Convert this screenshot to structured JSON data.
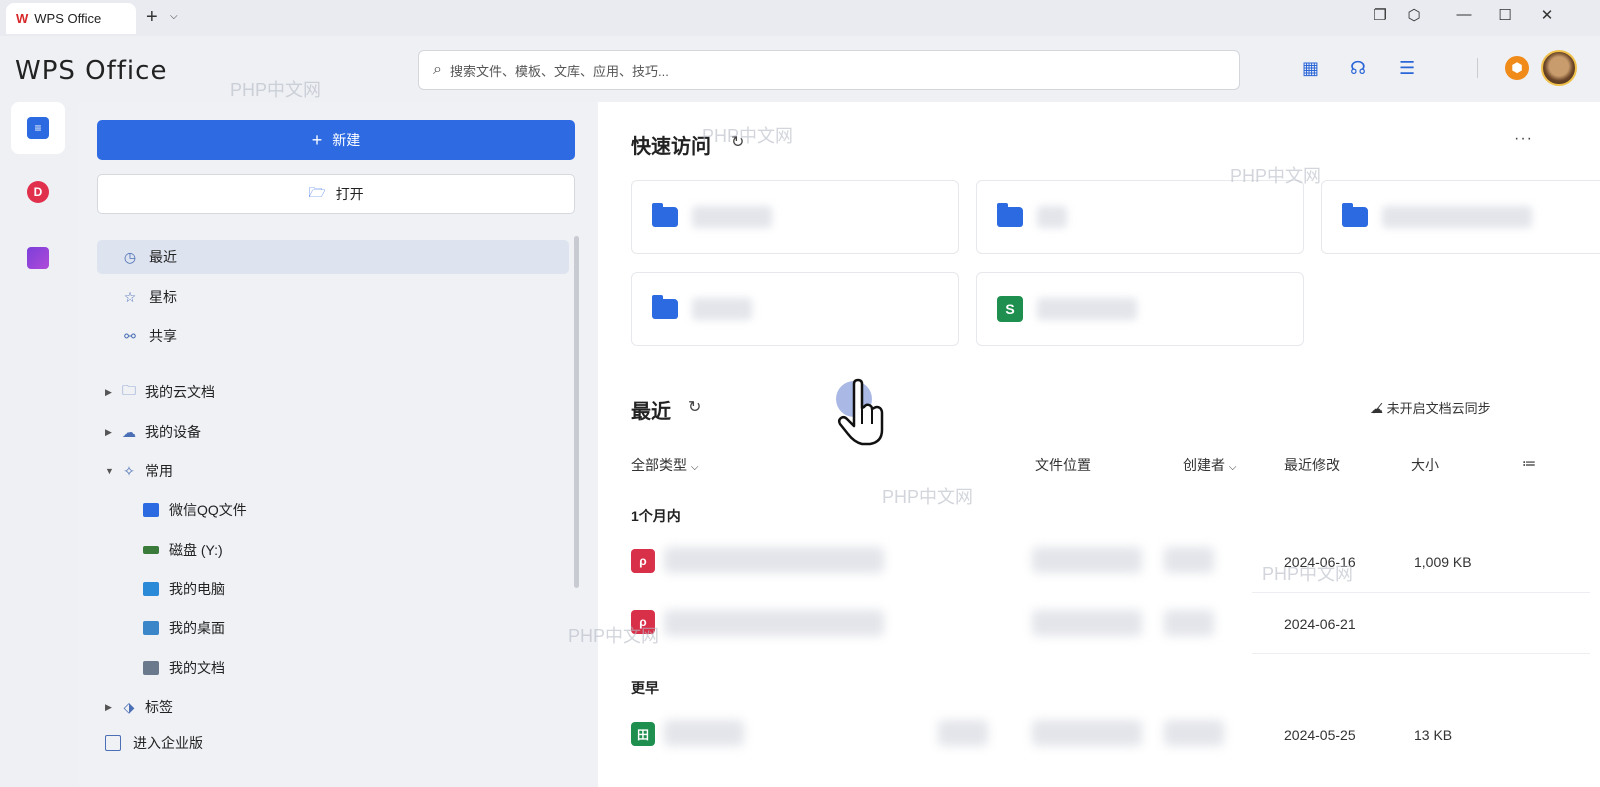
{
  "tab": {
    "title": "WPS Office"
  },
  "header": {
    "brand": "WPS Office",
    "search_placeholder": "搜索文件、模板、文库、应用、技巧..."
  },
  "sidebar": {
    "new_label": "新建",
    "open_label": "打开",
    "nav": [
      {
        "label": "最近",
        "icon": "clock-icon"
      },
      {
        "label": "星标",
        "icon": "star-icon"
      },
      {
        "label": "共享",
        "icon": "share-icon"
      }
    ],
    "tree": [
      {
        "label": "我的云文档",
        "icon": "folder-icon"
      },
      {
        "label": "我的设备",
        "icon": "cloud-device-icon"
      },
      {
        "label": "常用",
        "icon": "pin-icon"
      }
    ],
    "common": [
      {
        "label": "微信QQ文件",
        "color": "#2b6ae0"
      },
      {
        "label": "磁盘 (Y:)",
        "color": "#3a7a3a"
      },
      {
        "label": "我的电脑",
        "color": "#2a8ad8"
      },
      {
        "label": "我的桌面",
        "color": "#3a86c8"
      },
      {
        "label": "我的文档",
        "color": "#6a7a8c"
      }
    ],
    "tags_label": "标签",
    "enterprise_label": "进入企业版"
  },
  "main": {
    "quick_access_title": "快速访问",
    "recent_title": "最近",
    "sync_status": "未开启文档云同步",
    "columns": {
      "type": "全部类型",
      "location": "文件位置",
      "creator": "创建者",
      "modified": "最近修改",
      "size": "大小"
    },
    "groups": {
      "month": "1个月内",
      "earlier": "更早"
    },
    "rows": [
      {
        "modified": "2024-06-16",
        "size": "1,009 KB",
        "color": "#d9304a",
        "glyph": "P"
      },
      {
        "modified": "2024-06-21",
        "size": "",
        "color": "#d9304a",
        "glyph": "P"
      },
      {
        "modified": "2024-05-25",
        "size": "13 KB",
        "color": "#1e8f4e",
        "glyph": "田"
      }
    ]
  },
  "watermark": "PHP中文网",
  "colors": {
    "accent": "#2e6be3",
    "brand_red": "#d7282a"
  }
}
